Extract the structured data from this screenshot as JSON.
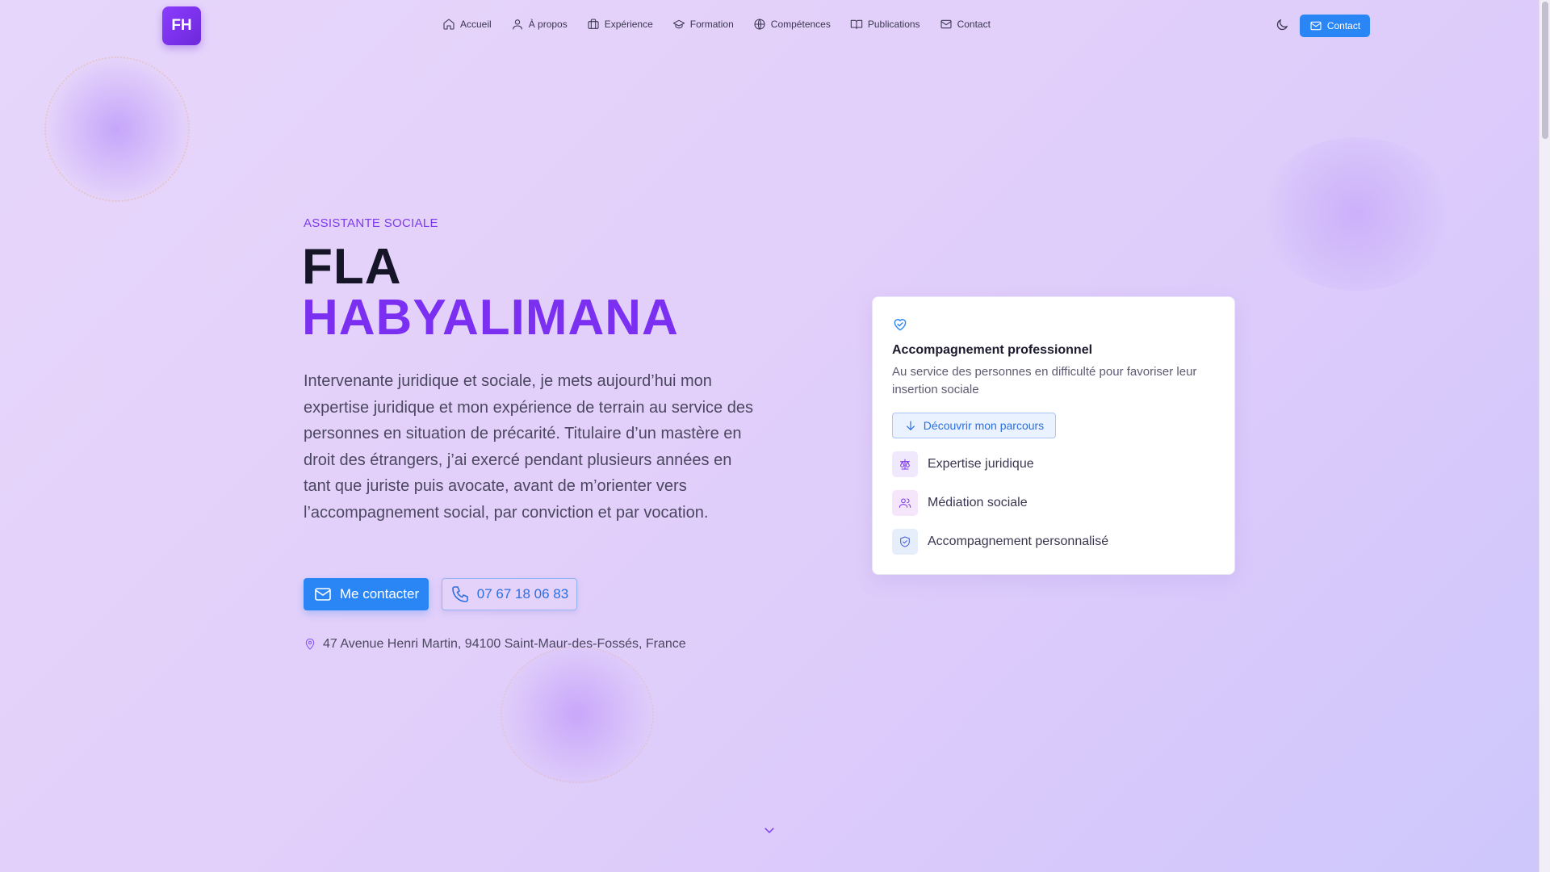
{
  "logo": {
    "initials": "FH"
  },
  "nav": {
    "items": [
      {
        "label": "Accueil",
        "icon": "home-icon"
      },
      {
        "label": "À propos",
        "icon": "user-icon"
      },
      {
        "label": "Expérience",
        "icon": "briefcase-icon"
      },
      {
        "label": "Formation",
        "icon": "graduation-cap-icon"
      },
      {
        "label": "Compétences",
        "icon": "globe-icon"
      },
      {
        "label": "Publications",
        "icon": "book-icon"
      },
      {
        "label": "Contact",
        "icon": "mail-icon"
      }
    ],
    "theme_toggle_icon": "moon-icon",
    "contact_button": "Contact"
  },
  "hero": {
    "eyebrow": "ASSISTANTE SOCIALE",
    "first_name": "FLA",
    "last_name": "HABYALIMANA",
    "intro": "Intervenante juridique et sociale, je mets aujourd’hui mon expertise juridique et mon expérience de terrain au service des personnes en situation de précarité. Titulaire d’un mastère en droit des étrangers, j’ai exercé pendant plusieurs années en tant que juriste puis avocate, avant de m’orienter vers l’accompagnement social, par conviction et par vocation.",
    "primary_button": "Me contacter",
    "phone_button": "07 67 18 06 83",
    "address": "47 Avenue Henri Martin, 94100 Saint-Maur-des-Fossés, France"
  },
  "card": {
    "icon": "heart-handshake-icon",
    "title": "Accompagnement professionnel",
    "description": "Au service des personnes en difficulté pour favoriser leur insertion sociale",
    "link": "Découvrir mon parcours",
    "features": [
      {
        "label": "Expertise juridique",
        "icon": "scale-icon"
      },
      {
        "label": "Médiation sociale",
        "icon": "users-icon"
      },
      {
        "label": "Accompagnement personnalisé",
        "icon": "shield-check-icon"
      }
    ]
  },
  "colors": {
    "accent_purple": "#7b2ff0",
    "primary_blue": "#2b86f5",
    "background": "#e2cffa"
  }
}
